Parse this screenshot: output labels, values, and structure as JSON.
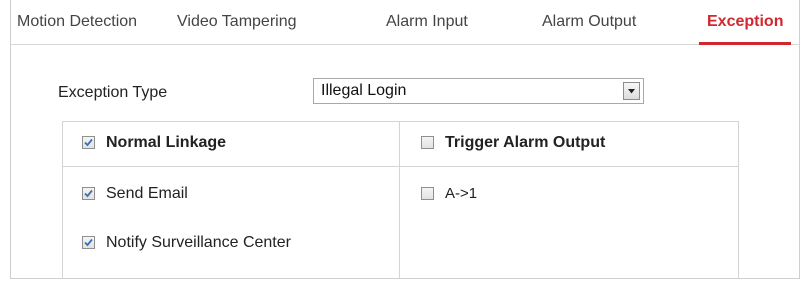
{
  "tabs": [
    {
      "label": "Motion Detection",
      "active": false
    },
    {
      "label": "Video Tampering",
      "active": false
    },
    {
      "label": "Alarm Input",
      "active": false
    },
    {
      "label": "Alarm Output",
      "active": false
    },
    {
      "label": "Exception",
      "active": true
    }
  ],
  "exception": {
    "type_label": "Exception Type",
    "type_value": "Illegal Login",
    "dropdown_icon": "chevron-down-icon"
  },
  "linkage": {
    "normal": {
      "header": {
        "label": "Normal Linkage",
        "checked": true
      },
      "items": [
        {
          "label": "Send Email",
          "checked": true
        },
        {
          "label": "Notify Surveillance Center",
          "checked": true
        }
      ]
    },
    "trigger": {
      "header": {
        "label": "Trigger Alarm Output",
        "checked": false
      },
      "items": [
        {
          "label": "A->1",
          "checked": false
        }
      ]
    }
  },
  "colors": {
    "active_tab": "#d0282e",
    "checkmark": "#3a6fb5"
  }
}
